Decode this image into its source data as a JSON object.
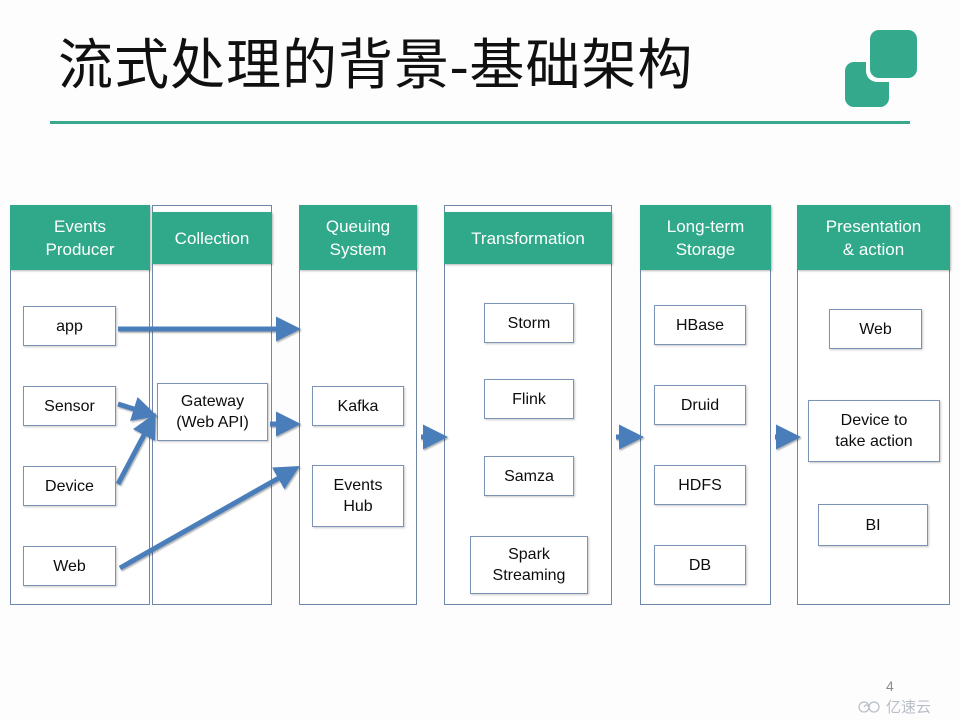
{
  "slide": {
    "title": "流式处理的背景-基础架构",
    "page_number": "4",
    "accent_color": "#2fa98a",
    "arrow_color": "#4a7ebb",
    "box_border_color": "#7b93b4"
  },
  "logo": {
    "name": "brand-logo",
    "color": "#34a98c"
  },
  "watermark": {
    "text": "亿速云",
    "icon": "cloud-icon",
    "color": "#b9bfc8"
  },
  "diagram": {
    "type": "pipeline",
    "columns": [
      {
        "id": "events-producer",
        "header": "Events\nProducer",
        "header_line1": "Events",
        "header_line2": "Producer",
        "nodes": [
          "app",
          "Sensor",
          "Device",
          "Web"
        ]
      },
      {
        "id": "collection",
        "header": "Collection",
        "header_line1": "Collection",
        "header_line2": "",
        "nodes": [
          "Gateway\n(Web API)"
        ]
      },
      {
        "id": "queuing-system",
        "header": "Queuing\nSystem",
        "header_line1": "Queuing",
        "header_line2": "System",
        "nodes": [
          "Kafka",
          "Events\nHub"
        ]
      },
      {
        "id": "transformation",
        "header": "Transformation",
        "header_line1": "Transformation",
        "header_line2": "",
        "nodes": [
          "Storm",
          "Flink",
          "Samza",
          "Spark\nStreaming"
        ]
      },
      {
        "id": "long-term-storage",
        "header": "Long-term\nStorage",
        "header_line1": "Long-term",
        "header_line2": "Storage",
        "nodes": [
          "HBase",
          "Druid",
          "HDFS",
          "DB"
        ]
      },
      {
        "id": "presentation-action",
        "header": "Presentation\n& action",
        "header_line1": "Presentation",
        "header_line2": "& action",
        "nodes": [
          "Web",
          "Device to\ntake action",
          "BI"
        ]
      }
    ],
    "nodes": {
      "app": "app",
      "sensor": "Sensor",
      "device": "Device",
      "web_producer": "Web",
      "gateway_line1": "Gateway",
      "gateway_line2": "(Web API)",
      "kafka": "Kafka",
      "events_hub_line1": "Events",
      "events_hub_line2": "Hub",
      "storm": "Storm",
      "flink": "Flink",
      "samza": "Samza",
      "spark_line1": "Spark",
      "spark_line2": "Streaming",
      "hbase": "HBase",
      "druid": "Druid",
      "hdfs": "HDFS",
      "db": "DB",
      "web_presentation": "Web",
      "device_action_line1": "Device to",
      "device_action_line2": "take action",
      "bi": "BI"
    },
    "connections": [
      {
        "from": "app",
        "to": "queuing-system"
      },
      {
        "from": "Sensor",
        "to": "Gateway (Web API)"
      },
      {
        "from": "Device",
        "to": "Gateway (Web API)"
      },
      {
        "from": "Web",
        "to": "queuing-system"
      },
      {
        "from": "Gateway (Web API)",
        "to": "queuing-system"
      },
      {
        "from": "queuing-system",
        "to": "transformation"
      },
      {
        "from": "transformation",
        "to": "long-term-storage"
      },
      {
        "from": "long-term-storage",
        "to": "presentation-action"
      }
    ]
  }
}
